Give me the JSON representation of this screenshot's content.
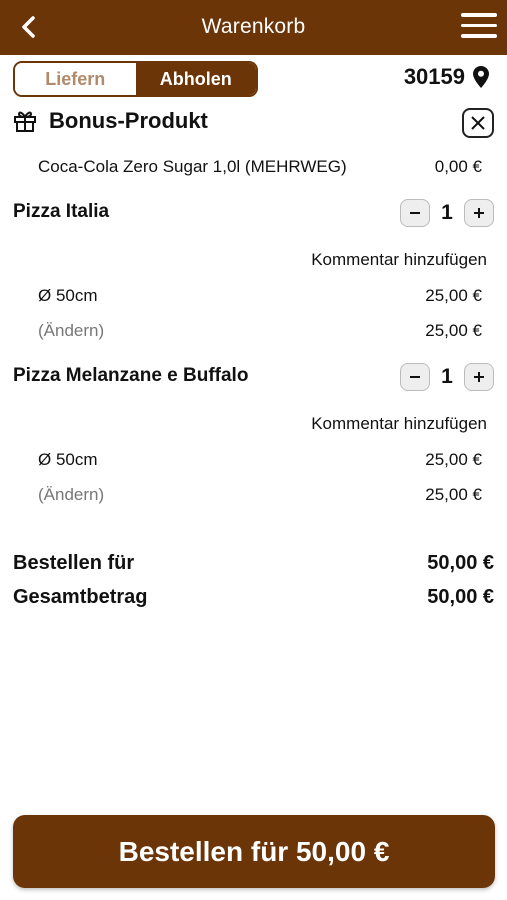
{
  "header": {
    "title": "Warenkorb",
    "back_icon": "chevron-left-icon",
    "menu_icon": "hamburger-menu-icon"
  },
  "delivery_toggle": {
    "options": [
      "Liefern",
      "Abholen"
    ],
    "selected": "Abholen"
  },
  "location": {
    "zip": "30159",
    "icon": "map-pin-icon"
  },
  "bonus": {
    "title": "Bonus-Produkt",
    "icon": "gift-icon",
    "product": "Coca-Cola Zero Sugar 1,0l (MEHRWEG)",
    "price": "0,00 €"
  },
  "items": [
    {
      "name": "Pizza Italia",
      "qty": "1",
      "comment_label": "Kommentar hinzufügen",
      "size": "Ø 50cm",
      "size_price": "25,00 €",
      "change_label": "(Ändern)",
      "total": "25,00 €"
    },
    {
      "name": "Pizza Melanzane e Buffalo",
      "qty": "1",
      "comment_label": "Kommentar hinzufügen",
      "size": "Ø 50cm",
      "size_price": "25,00 €",
      "change_label": "(Ändern)",
      "total": "25,00 €"
    }
  ],
  "summary": {
    "order_for_label": "Bestellen für",
    "order_for_value": "50,00 €",
    "total_label": "Gesamtbetrag",
    "total_value": "50,00 €"
  },
  "order_button": "Bestellen für 50,00 €",
  "colors": {
    "brand": "#6b3507",
    "muted_brand": "#b08a6a"
  }
}
